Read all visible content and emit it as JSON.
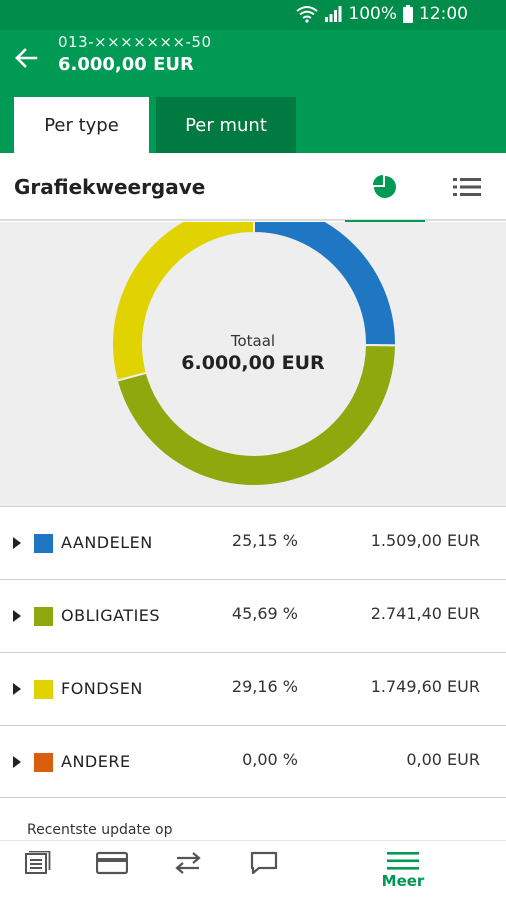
{
  "status": {
    "battery": "100%",
    "time": "12:00"
  },
  "header": {
    "account": "013-×××××××-50",
    "balance": "6.000,00 EUR"
  },
  "tabs": [
    {
      "label": "Per type",
      "active": true
    },
    {
      "label": "Per munt",
      "active": false
    }
  ],
  "view": {
    "title": "Grafiekweergave"
  },
  "donut": {
    "center_label": "Totaal",
    "center_value": "6.000,00 EUR"
  },
  "chart_data": {
    "type": "pie",
    "categories": [
      "AANDELEN",
      "OBLIGATIES",
      "FONDSEN",
      "ANDERE"
    ],
    "values": [
      25.15,
      45.69,
      29.16,
      0.0
    ],
    "colors": [
      "#1f77c4",
      "#8fa80e",
      "#e1d301",
      "#d95f0e"
    ]
  },
  "rows": [
    {
      "name": "AANDELEN",
      "percent": "25,15 %",
      "amount": "1.509,00 EUR",
      "color": "#1f77c4"
    },
    {
      "name": "OBLIGATIES",
      "percent": "45,69 %",
      "amount": "2.741,40 EUR",
      "color": "#8fa80e"
    },
    {
      "name": "FONDSEN",
      "percent": "29,16 %",
      "amount": "1.749,60 EUR",
      "color": "#e1d301"
    },
    {
      "name": "ANDERE",
      "percent": "0,00 %",
      "amount": "0,00 EUR",
      "color": "#d95f0e"
    }
  ],
  "footer": {
    "update_text": "Recentste update op"
  },
  "nav": {
    "items": [
      {
        "icon": "list-icon"
      },
      {
        "icon": "card-icon"
      },
      {
        "icon": "transfer-icon"
      },
      {
        "icon": "chat-icon"
      },
      {
        "icon": "menu-icon",
        "label": "Meer"
      }
    ]
  },
  "theme": {
    "primary": "#009a55",
    "dark": "#007a40",
    "statusbar": "#008c4a"
  }
}
